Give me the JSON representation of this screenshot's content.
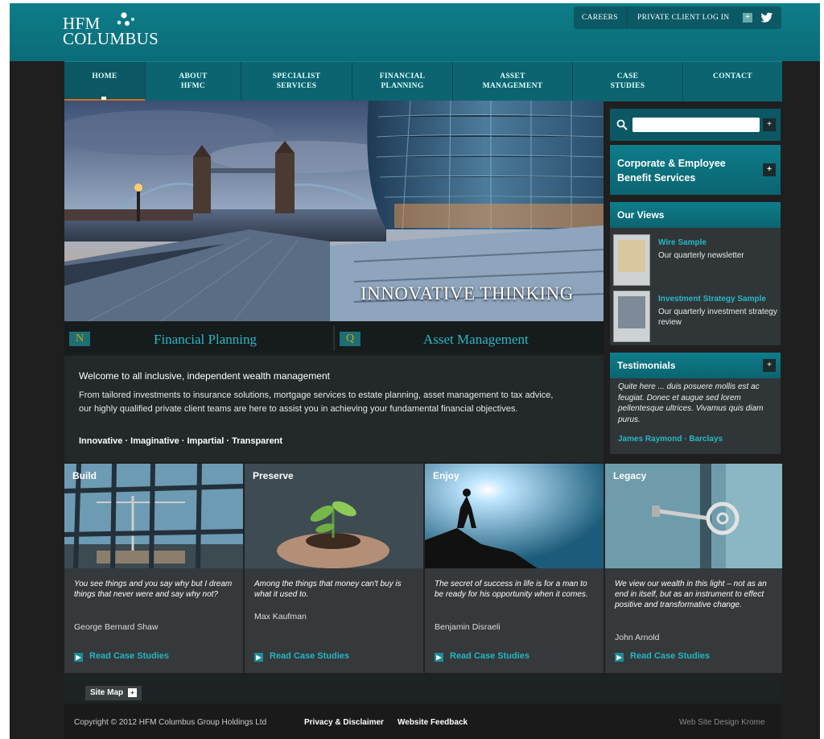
{
  "brand": {
    "line1": "HFM",
    "line2": "COLUMBUS"
  },
  "toplinks": {
    "careers": "CAREERS",
    "login": "PRIVATE CLIENT LOG IN",
    "arrow": "+",
    "social_icon": "twitter-icon"
  },
  "nav": {
    "items": [
      {
        "label": "HOME"
      },
      {
        "label": "ABOUT HFMC"
      },
      {
        "label": "SPECIALIST SERVICES"
      },
      {
        "label": "FINANCIAL PLANNING"
      },
      {
        "label": "ASSET MANAGEMENT"
      },
      {
        "label": "CASE STUDIES"
      },
      {
        "label": "CONTACT"
      }
    ]
  },
  "hero": {
    "caption": "INNOVATIVE THINKING"
  },
  "promo": [
    {
      "icon_text": "N",
      "label": "Financial Planning"
    },
    {
      "icon_text": "Q",
      "label": "Asset Management"
    }
  ],
  "welcome": {
    "title": "Welcome to all inclusive, independent wealth management",
    "body": "From tailored investments to insurance solutions, mortgage services to estate planning, asset management to tax advice, our highly qualified private client teams are here to assist you in achieving your fundamental financial objectives.",
    "tagline": "Innovative · Imaginative · Impartial · Transparent"
  },
  "sidebar": {
    "search": {
      "placeholder": "",
      "button": "+"
    },
    "corporate": {
      "label": "Corporate & Employee Benefit Services",
      "button": "+"
    },
    "views": {
      "title": "Our Views",
      "items": [
        {
          "title": "Wire Sample",
          "desc": "Our quarterly newsletter"
        },
        {
          "title": "Investment Strategy Sample",
          "desc": "Our quarterly investment strategy review"
        }
      ]
    },
    "testimonials": {
      "title": "Testimonials",
      "button": "+",
      "quote": "Quite here ... duis posuere mollis est ac feugiat. Donec et augue sed lorem pellentesque ultrices. Vivamus quis diam purus.",
      "author": "James Raymond · Barclays"
    }
  },
  "cards": [
    {
      "title": "Build",
      "quote": "You see things and you say why but I dream things that never were and say why not?",
      "author": "George Bernard Shaw",
      "link": "Read Case Studies"
    },
    {
      "title": "Preserve",
      "quote": "Among the things that money can't buy is what it used to.",
      "author": "Max Kaufman",
      "link": "Read Case Studies"
    },
    {
      "title": "Enjoy",
      "quote": "The secret of success in life is for a man to be ready for his opportunity when it comes.",
      "author": "Benjamin Disraeli",
      "link": "Read Case Studies"
    },
    {
      "title": "Legacy",
      "quote": "We view our wealth in this light – not as an end in itself, but as an instrument to effect positive and transformative change.",
      "author": "John Arnold",
      "link": "Read Case Studies"
    }
  ],
  "footer": {
    "sitemap": "Site Map",
    "sitemap_btn": "+",
    "copyright": "Copyright © 2012 HFM Columbus Group Holdings Ltd",
    "privacy": "Privacy & Disclaimer",
    "feedback": "Website Feedback",
    "credit": "Web Site Design Krome"
  },
  "colors": {
    "teal": "#0e7d8a",
    "accent": "#26b8c6",
    "orange": "#d96d1e",
    "background": "#1f1f1f"
  }
}
